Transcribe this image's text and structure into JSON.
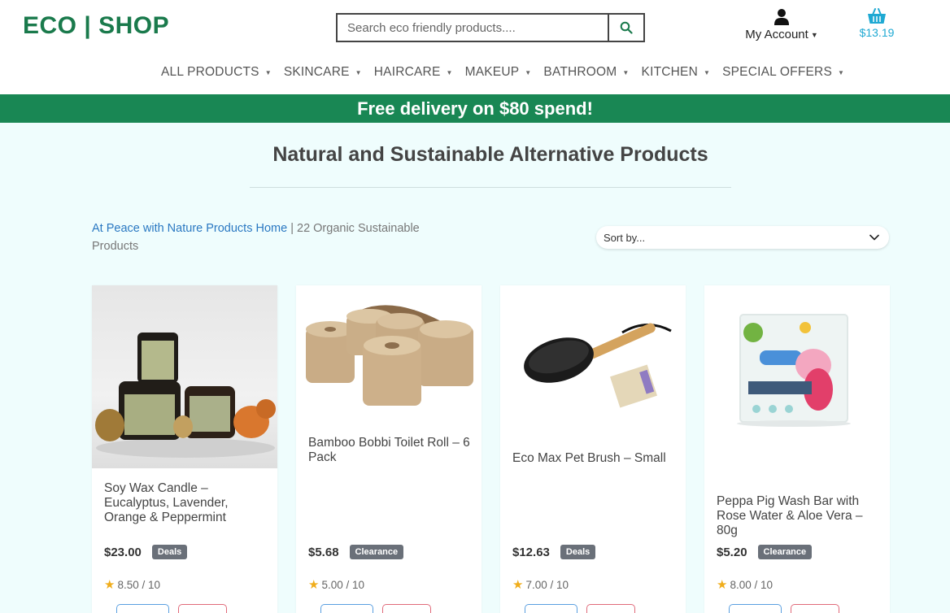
{
  "header": {
    "logo": "ECO | SHOP",
    "search_placeholder": "Search eco friendly products....",
    "account_label": "My Account",
    "cart_total": "$13.19"
  },
  "nav": [
    {
      "label": "ALL PRODUCTS"
    },
    {
      "label": "SKINCARE"
    },
    {
      "label": "HAIRCARE"
    },
    {
      "label": "MAKEUP"
    },
    {
      "label": "BATHROOM"
    },
    {
      "label": "KITCHEN"
    },
    {
      "label": "SPECIAL OFFERS"
    }
  ],
  "banner": "Free delivery on $80 spend!",
  "main": {
    "title": "Natural and Sustainable Alternative Products",
    "breadcrumb_link": "At Peace with Nature Products Home",
    "breadcrumb_sep": " | ",
    "breadcrumb_text": "22 Organic Sustainable Products",
    "sort_label": "Sort by..."
  },
  "products": [
    {
      "name": "Soy Wax Candle – Eucalyptus, Lavender, Orange & Peppermint",
      "price": "$23.00",
      "badge": "Deals",
      "rating": "8.50 / 10"
    },
    {
      "name": "Bamboo Bobbi Toilet Roll – 6 Pack",
      "price": "$5.68",
      "badge": "Clearance",
      "rating": "5.00 / 10"
    },
    {
      "name": "Eco Max Pet Brush – Small",
      "price": "$12.63",
      "badge": "Deals",
      "rating": "7.00 / 10"
    },
    {
      "name": "Peppa Pig Wash Bar with Rose Water & Aloe Vera – 80g",
      "price": "$5.20",
      "badge": "Clearance",
      "rating": "8.00 / 10"
    }
  ],
  "colors": {
    "brand_green": "#1a7a4c",
    "banner_green": "#198754",
    "cart_blue": "#1fa9d3",
    "page_bg": "#effdfd"
  }
}
